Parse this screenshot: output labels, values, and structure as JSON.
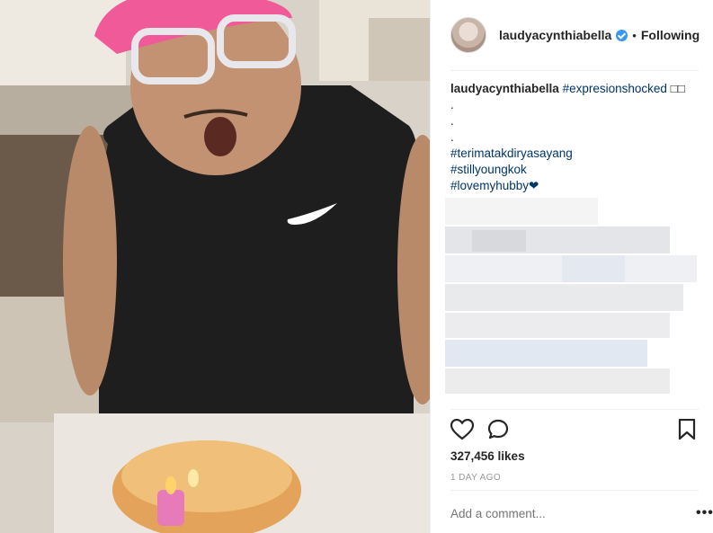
{
  "post": {
    "username": "laudyacynthiabella",
    "follow_label": "Following",
    "separator": "•",
    "caption": {
      "username": "laudyacynthiabella",
      "first_tag": "#expresionshocked",
      "first_suffix": " □□",
      "dots": [
        ".",
        ".",
        "."
      ],
      "tags": [
        "#terimatakdiryasayang",
        "#stillyoungkok",
        "#lovemyhubby❤"
      ]
    },
    "likes": "327,456 likes",
    "time": "1 DAY AGO",
    "comment_placeholder": "Add a comment...",
    "more_label": "•••"
  },
  "icons": {
    "verified": "verified-badge-icon",
    "like": "heart-icon",
    "comment": "comment-icon",
    "save": "bookmark-icon"
  },
  "colors": {
    "hashtag": "#003569",
    "verified": "#3897f0",
    "muted": "#999999"
  }
}
